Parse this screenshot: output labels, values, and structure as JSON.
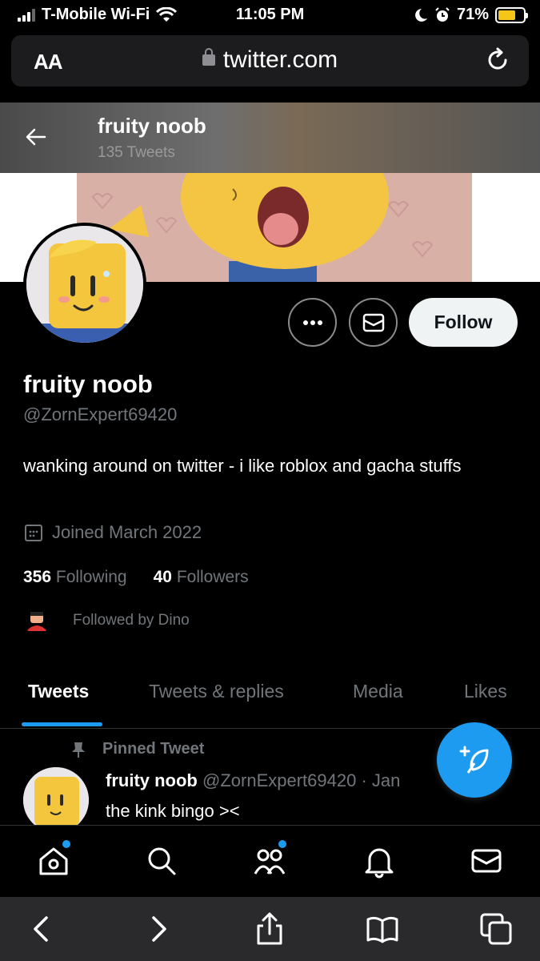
{
  "status_bar": {
    "carrier": "T-Mobile Wi-Fi",
    "time": "11:05 PM",
    "battery": "71%",
    "battery_level": 0.71
  },
  "browser": {
    "aa_label": "AA",
    "url": "twitter.com"
  },
  "header": {
    "name": "fruity noob",
    "tweet_count": "135 Tweets"
  },
  "profile": {
    "display_name": "fruity noob",
    "handle": "@ZornExpert69420",
    "bio": "wanking around on twitter - i like roblox and gacha stuffs",
    "joined": "Joined March 2022",
    "following_count": "356",
    "following_label": "Following",
    "followers_count": "40",
    "followers_label": "Followers",
    "followed_by": "Followed by Dino"
  },
  "actions": {
    "follow_label": "Follow"
  },
  "tabs": [
    {
      "label": "Tweets",
      "active": true
    },
    {
      "label": "Tweets & replies",
      "active": false
    },
    {
      "label": "Media",
      "active": false
    },
    {
      "label": "Likes",
      "active": false
    }
  ],
  "tweet": {
    "pinned_label": "Pinned Tweet",
    "name": "fruity noob",
    "handle": "@ZornExpert69420",
    "separator": "·",
    "date": "Jan",
    "text": "the kink bingo ><"
  },
  "colors": {
    "accent": "#1d9bf0",
    "background": "#000000",
    "muted": "#71767b"
  },
  "nav_icons": [
    "home-icon",
    "search-icon",
    "communities-icon",
    "notifications-icon",
    "messages-icon"
  ],
  "safari_icons": [
    "back-icon",
    "forward-icon",
    "share-icon",
    "bookmarks-icon",
    "tabs-icon"
  ]
}
